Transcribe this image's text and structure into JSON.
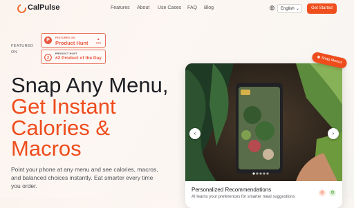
{
  "brand": {
    "name": "CalPulse",
    "accent": "#ee4c1c"
  },
  "nav": {
    "links": [
      "Features",
      "About",
      "Use Cases",
      "FAQ",
      "Blog"
    ],
    "language": "English",
    "cta_label": "Get Started"
  },
  "featured": {
    "label_line1": "FEATURED",
    "label_line2": "ON",
    "badges": [
      {
        "kicker": "FEATURED ON",
        "title": "Product Hunt",
        "count": "376",
        "icon": "product-hunt-icon"
      },
      {
        "kicker": "PRODUCT HUNT",
        "title": "#2 Product of the Day",
        "icon": "medal-icon"
      }
    ]
  },
  "hero": {
    "line1": "Snap Any Menu,",
    "line2": "Get Instant",
    "line3": "Calories &",
    "line4": "Macros",
    "subtitle": "Point your phone at any menu and see calories, macros, and balanced choices instantly. Eat smarter every time you order."
  },
  "showcase": {
    "badge": "Snap Menus",
    "card_title": "Personalized Recommendations",
    "card_desc": "AI learns your preferences for smarter meal suggestions"
  }
}
